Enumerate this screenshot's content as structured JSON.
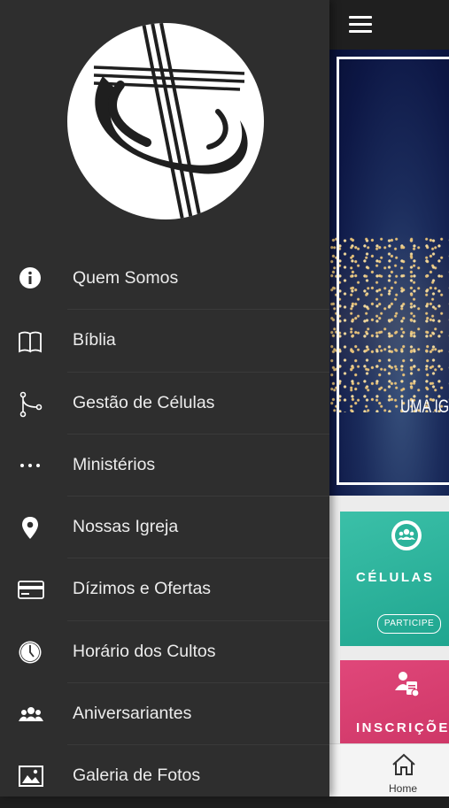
{
  "banner": {
    "text": "UMA IG"
  },
  "cards": [
    {
      "title": "CÉLULAS",
      "button": "PARTICIPE",
      "icon": "people-group-icon",
      "color": "#2bb39b"
    },
    {
      "title": "INSCRIÇÕE",
      "icon": "clipboard-person-icon",
      "color": "#d63a6c"
    }
  ],
  "bottom_nav": {
    "home_label": "Home"
  },
  "drawer": {
    "logo": "church-cross-logo",
    "items": [
      {
        "label": "Quem Somos",
        "icon": "info-circle-icon"
      },
      {
        "label": "Bíblia",
        "icon": "open-book-icon"
      },
      {
        "label": "Gestão de Células",
        "icon": "branch-icon"
      },
      {
        "label": "Ministérios",
        "icon": "more-dots-icon"
      },
      {
        "label": "Nossas Igreja",
        "icon": "location-pin-icon"
      },
      {
        "label": "Dízimos e Ofertas",
        "icon": "credit-card-icon"
      },
      {
        "label": "Horário dos Cultos",
        "icon": "clock-icon"
      },
      {
        "label": "Aniversariantes",
        "icon": "people-icon"
      },
      {
        "label": "Galeria de Fotos",
        "icon": "photo-gallery-icon"
      }
    ]
  },
  "colors": {
    "drawer_bg": "#2e2e2e",
    "text": "#ececec",
    "topbar": "#1f1f1f"
  }
}
